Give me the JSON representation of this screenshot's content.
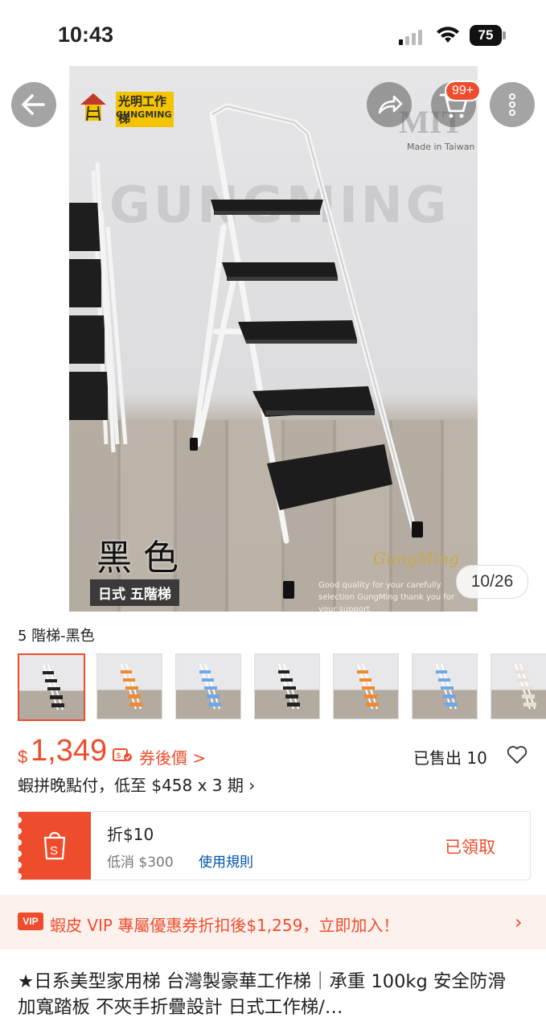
{
  "status_bar": {
    "time": "10:43",
    "battery": "75"
  },
  "gallery": {
    "brand_cn": "光明工作梯",
    "brand_en": "GUNGMING",
    "watermark": "GUNGMING",
    "mit": "MIT",
    "mit_sub": "Made in Taiwan",
    "color_label": "黑 色",
    "model_label": "日式 五階梯",
    "signature": "GungMing",
    "signature_sub": "Good quality for your carefully selection GungMing thank you for your support",
    "counter": "10/26",
    "cart_badge": "99+"
  },
  "variant": {
    "name": "5 階梯-黑色",
    "thumb_colors": [
      "#222222",
      "#f08a2c",
      "#6fa8e8",
      "#222222",
      "#f08a2c",
      "#6fa8e8",
      "#e8e0d4"
    ]
  },
  "price": {
    "currency": "$",
    "value": "1,349",
    "after_coupon": "券後價 >",
    "sold": "已售出 10"
  },
  "bnpl": {
    "text": "蝦拼晚點付，低至 $458 x 3 期 ›"
  },
  "voucher": {
    "title": "折$10",
    "min_spend": "低消 $300",
    "rules": "使用規則",
    "status": "已領取"
  },
  "vip": {
    "badge": "VIP",
    "text": "蝦皮 VIP 專屬優惠券折扣後$1,259，立即加入！",
    "chevron": "›"
  },
  "product": {
    "title": "★日系美型家用梯 台灣製豪華工作梯｜承重 100kg 安全防滑加寬踏板 不夾手折疊設計 日式工作梯/…"
  },
  "colors": {
    "accent": "#ee4d2d",
    "link": "#0055aa"
  }
}
